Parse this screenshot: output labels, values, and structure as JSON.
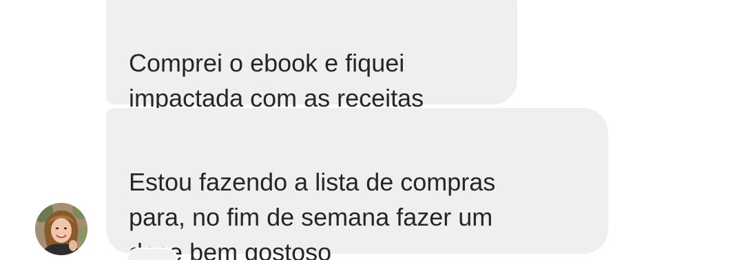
{
  "messages": [
    {
      "text": "Comprei o ebook e fiquei\nimpactada com as receitas",
      "direction": "incoming"
    },
    {
      "text": "Estou fazendo a lista de compras\npara, no fim de semana fazer um\ndoce bem gostoso",
      "direction": "incoming"
    }
  ],
  "colors": {
    "bubble_background": "#efefef",
    "text": "#262626",
    "page_background": "#ffffff"
  }
}
